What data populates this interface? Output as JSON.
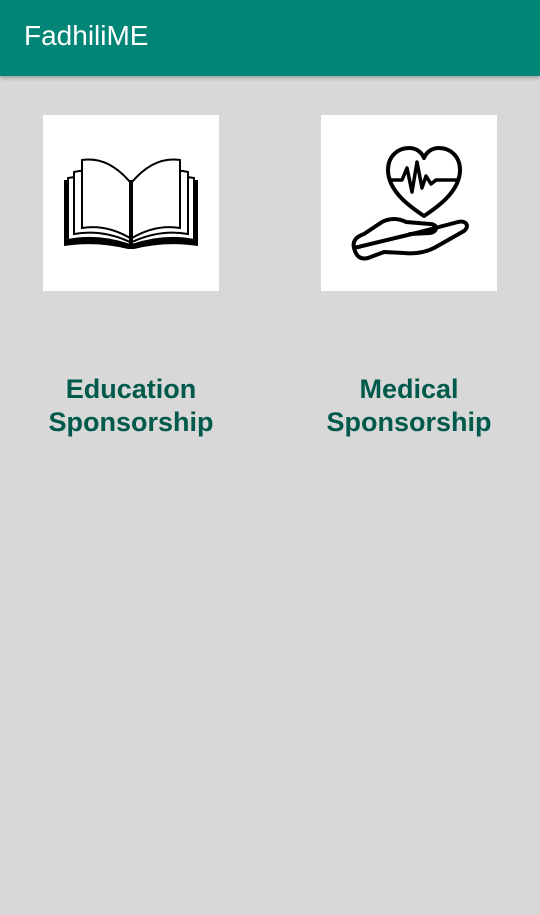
{
  "app_bar": {
    "title": "FadhiliME",
    "color": "#008577"
  },
  "cards": [
    {
      "label": "Education\nSponsorship",
      "label_line1": "Education",
      "label_line2": "Sponsorship",
      "icon": "open-book-icon"
    },
    {
      "label": "Medical\nSponsorship",
      "label_line1": "Medical",
      "label_line2": "Sponsorship",
      "icon": "heart-hand-icon"
    }
  ],
  "colors": {
    "background": "#d8d8d8",
    "label_text": "#005a4b",
    "tile": "#ffffff"
  }
}
